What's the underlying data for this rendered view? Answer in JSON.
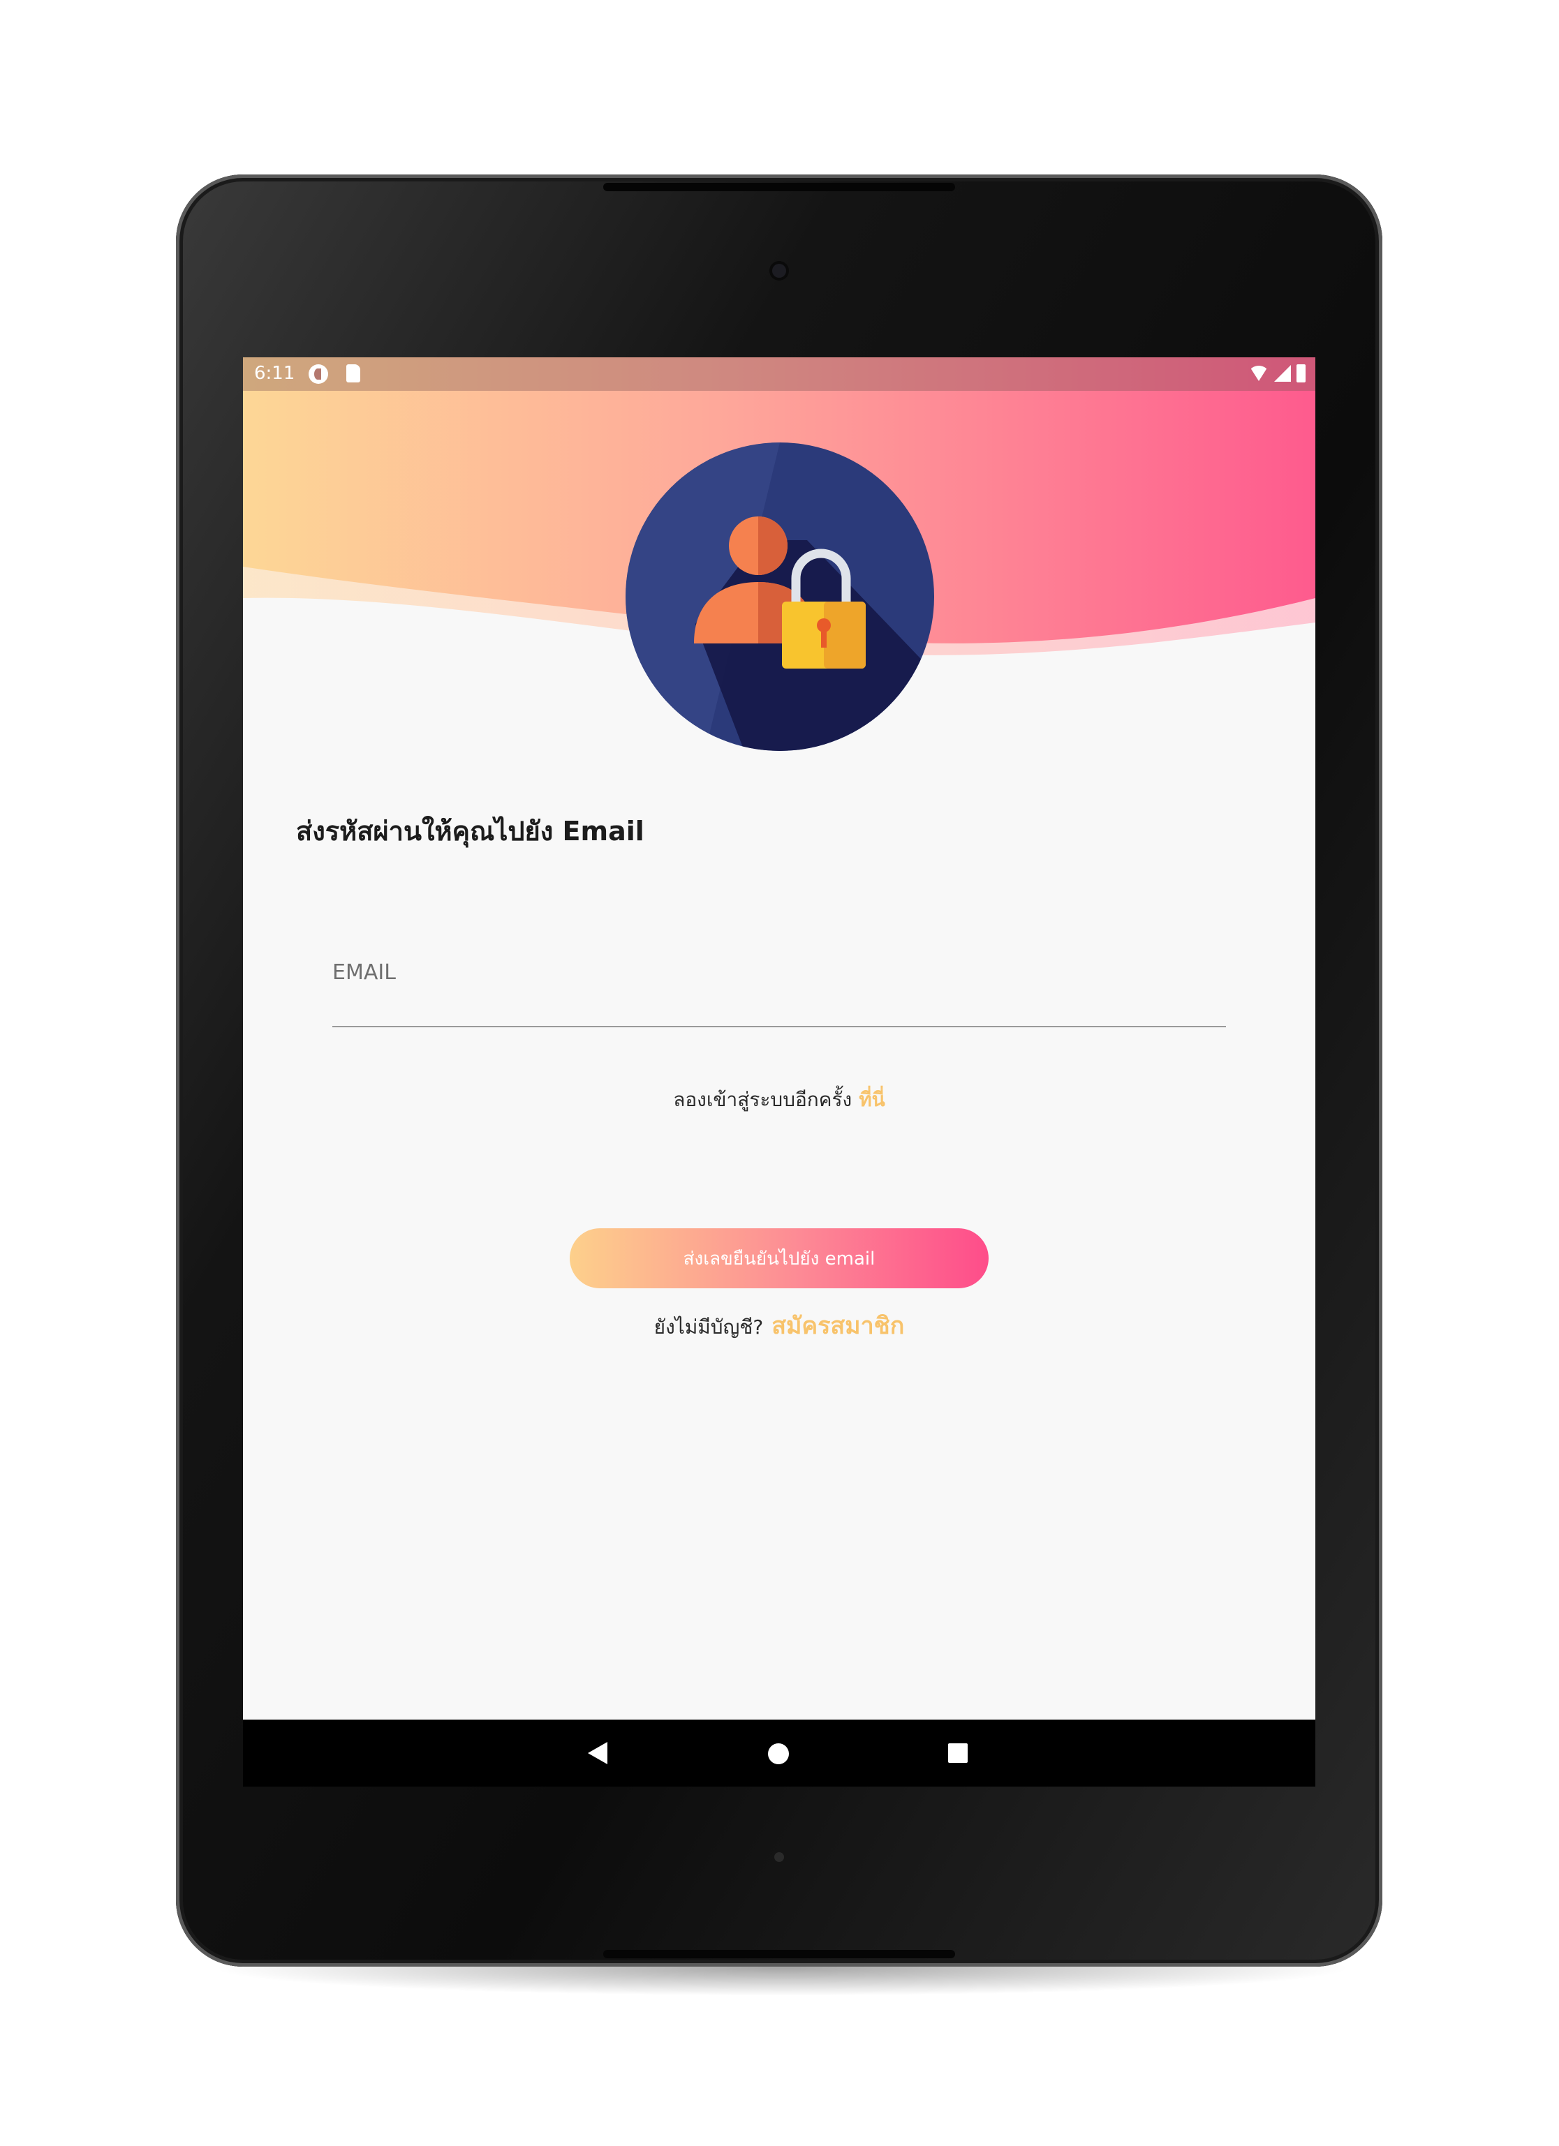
{
  "status_bar": {
    "time": "6:11",
    "left_icons": [
      "app-notification-icon",
      "sd-card-icon"
    ],
    "right_icons": [
      "wifi-icon",
      "signal-icon",
      "battery-icon"
    ]
  },
  "header": {
    "gradient_colors": [
      "#fdd08b",
      "#fea59a",
      "#fe5b8e"
    ],
    "icon": "user-lock-icon"
  },
  "form": {
    "title": "ส่งรหัสผ่านให้คุณไปยัง Email",
    "email_placeholder": "EMAIL",
    "email_value": "",
    "retry_text": "ลองเข้าสู่ระบบอีกครั้ง",
    "retry_link": "ที่นี่",
    "send_button": "ส่งเลขยืนยันไปยัง email",
    "signup_text": "ยังไม่มีบัญชี?",
    "signup_link": "สมัครสมาชิก"
  },
  "colors": {
    "accent": "#f8c36b",
    "button_gradient_start": "#fdd08b",
    "button_gradient_end": "#fe4d8a",
    "background": "#f8f8f8",
    "circle": "#2b3a7a",
    "lock_body": "#f8c42e",
    "person": "#f5814f"
  },
  "navigation_bar": {
    "buttons": [
      "back-icon",
      "home-icon",
      "recents-icon"
    ]
  }
}
